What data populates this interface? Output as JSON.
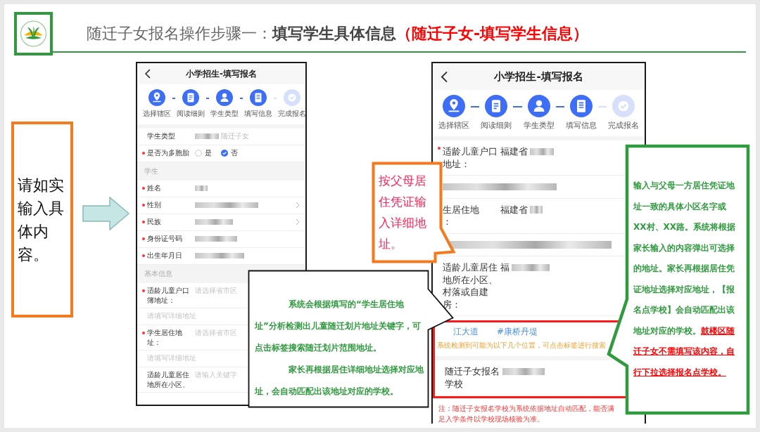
{
  "header": {
    "title_parts": [
      {
        "text": "随迁子女报名操作步骤一：",
        "kind": "plain"
      },
      {
        "text": "填写学生具体信息",
        "kind": "bold"
      },
      {
        "text": "（随迁子女-填写学生信息）",
        "kind": "red"
      }
    ]
  },
  "left_note": {
    "text": "请如实输入具体内容。"
  },
  "left_phone": {
    "title": "小学招生-填写报名",
    "steps": [
      {
        "label": "选择辖区",
        "done": true
      },
      {
        "label": "阅读细则",
        "done": true
      },
      {
        "label": "学生类型",
        "done": true
      },
      {
        "label": "填写信息",
        "done": true
      },
      {
        "label": "完成报名",
        "done": false
      }
    ],
    "rows": [
      {
        "kind": "field",
        "label_lines": [
          "学生类型"
        ],
        "blurred": true,
        "value": "随迁子女",
        "muted": true
      },
      {
        "kind": "radio",
        "label_lines": [
          "是否为多胞胎"
        ],
        "required": true,
        "options": [
          {
            "label": "是",
            "selected": false
          },
          {
            "label": "否",
            "selected": true
          }
        ]
      },
      {
        "kind": "section",
        "label": "学生"
      },
      {
        "kind": "field",
        "label_lines": [
          "姓名"
        ],
        "required": true,
        "blurred": true
      },
      {
        "kind": "field",
        "label_lines": [
          "性别"
        ],
        "required": true,
        "blurred": true,
        "chevron": true
      },
      {
        "kind": "field",
        "label_lines": [
          "民族"
        ],
        "required": true,
        "blurred": true,
        "chevron": true
      },
      {
        "kind": "field",
        "label_lines": [
          "身份证号码"
        ],
        "required": true,
        "blurred": true
      },
      {
        "kind": "field",
        "label_lines": [
          "出生年月日"
        ],
        "required": true,
        "blurred": true
      },
      {
        "kind": "section",
        "label": "基本信息"
      },
      {
        "kind": "field",
        "label_lines": [
          "适龄儿童户口",
          "簿地址："
        ],
        "required": true,
        "placeholder": "请选择省市区"
      },
      {
        "kind": "line",
        "placeholder": "请填写详细地址"
      },
      {
        "kind": "field",
        "label_lines": [
          "学生居住地",
          "址："
        ],
        "required": true,
        "placeholder": "请选择省市区"
      },
      {
        "kind": "line",
        "placeholder": "请填写详细地址"
      },
      {
        "kind": "field",
        "label_lines": [
          "适龄儿童居住",
          "地所在小区、"
        ],
        "placeholder": "请输入关键字"
      }
    ]
  },
  "right_phone": {
    "title": "小学招生-填写报名",
    "steps": [
      {
        "label": "选择辖区",
        "done": true
      },
      {
        "label": "阅读细则",
        "done": true
      },
      {
        "label": "学生类型",
        "done": true
      },
      {
        "label": "填写信息",
        "done": true
      },
      {
        "label": "完成报名",
        "done": false
      }
    ],
    "rows": [
      {
        "kind": "field",
        "label_lines": [
          "适龄儿童户口",
          "地址："
        ],
        "required": true,
        "value": "福建省",
        "blurred": true
      },
      {
        "kind": "line",
        "blurred": true
      },
      {
        "kind": "field",
        "label_lines": [
          "生居住地",
          "："
        ],
        "value": "福建省",
        "blurred": true
      },
      {
        "kind": "line",
        "blurred": true
      },
      {
        "kind": "field",
        "label_lines": [
          "适龄儿童居住",
          "地所在小区、",
          "村落或自建",
          "房："
        ],
        "value": "福",
        "blurred": true
      },
      {
        "kind": "highlight",
        "rows": [
          {
            "kind": "tags",
            "tags": [
              "江大道",
              "#康桥丹堤"
            ]
          },
          {
            "kind": "hint",
            "text": "系统检测到可能为以下几个位置，可点击标签进行搜索"
          },
          {
            "kind": "field",
            "label_lines": [
              "随迁子女报名",
              "学校"
            ],
            "blurred": true
          }
        ]
      },
      {
        "kind": "note",
        "text": "注：随迁子女报名学校为系统依据地址自动匹配，能否满足入学条件以学校现场核验为准。"
      }
    ]
  },
  "callout_black": {
    "paragraphs": [
      "系统会根据填写的“学生居住地址”分析检测出儿童随迁划片地址关键字，可点击标签搜索随迁划片范围地址。",
      "家长再根据居住详细地址选择对应地址，会自动匹配出该地址对应的学校。"
    ]
  },
  "callout_orange": {
    "text": "按父母居住凭证输入详细地址。"
  },
  "callout_green": {
    "text": "输入与父母一方居住凭证地址一致的具体小区名字或XX村、XX路。系统将根据家长输入的内容弹出可选择的地址。家长再根据居住凭证地址选择对应地址，【报名点学校】会自动匹配出该地址对应的学校。",
    "warning": "鼓楼区随迁子女不需填写该内容，自行下拉选择报名点学校。"
  }
}
